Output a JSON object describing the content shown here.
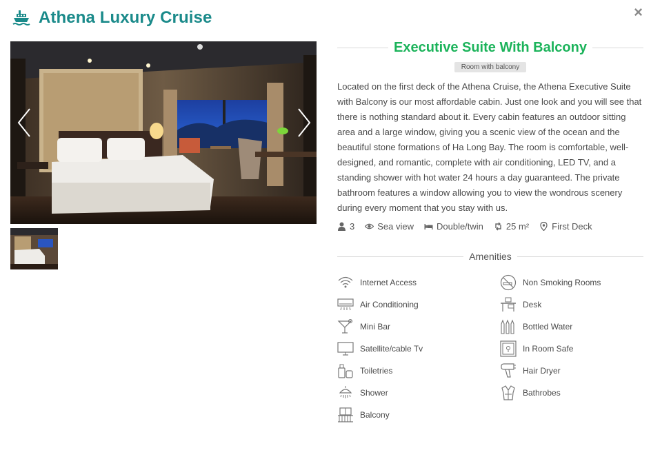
{
  "header": {
    "title": "Athena Luxury Cruise",
    "close_label": "×"
  },
  "gallery": {
    "photo_alt": "Executive Suite bedroom with balcony window",
    "prev_label": "Previous",
    "next_label": "Next"
  },
  "room": {
    "title": "Executive Suite With Balcony",
    "tag": "Room with balcony",
    "description": "Located on the first deck of the Athena Cruise, the Athena Executive Suite with Balcony is our most affordable cabin.  Just one look and you will see that there is nothing standard about it.  Every cabin features an outdoor sitting area and a large window, giving you a scenic view of the ocean and the beautiful stone formations of Ha Long Bay.  The room is comfortable, well-designed, and romantic, complete with air conditioning, LED TV, and a standing shower with hot water 24 hours a day guaranteed.  The private bathroom features a window allowing you to view the wondrous scenery during every moment that you stay with us.",
    "specs": {
      "guests": "3",
      "view": "Sea view",
      "bed": "Double/twin",
      "size": "25 m²",
      "deck": "First Deck"
    }
  },
  "amenities": {
    "title": "Amenities",
    "left": [
      "Internet Access",
      "Air Conditioning",
      "Mini Bar",
      "Satellite/cable Tv",
      "Toiletries",
      "Shower",
      "Balcony"
    ],
    "right": [
      "Non Smoking Rooms",
      "Desk",
      "Bottled Water",
      "In Room Safe",
      "Hair Dryer",
      "Bathrobes"
    ]
  },
  "colors": {
    "brand": "#1a8a8a",
    "room_title": "#1bb35a"
  }
}
